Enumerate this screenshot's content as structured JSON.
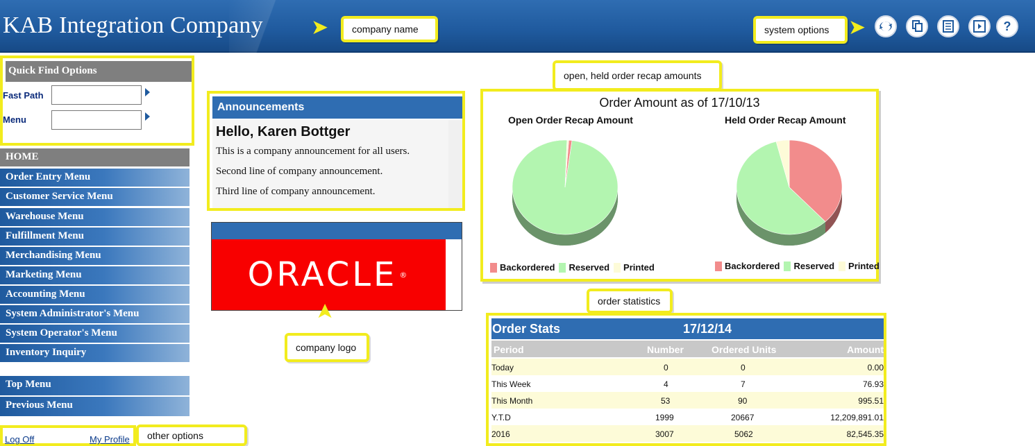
{
  "header": {
    "company_name": "KAB Integration Company"
  },
  "callouts": {
    "company_name": "company name",
    "system_options": "system options",
    "recap": "open, held order recap amounts",
    "order_statistics": "order statistics",
    "company_logo": "company logo",
    "other_options": "other options"
  },
  "system_buttons": [
    "refresh-icon",
    "copy-icon",
    "report-icon",
    "logout-icon",
    "help-icon"
  ],
  "quick_find": {
    "title": "Quick Find Options",
    "fast_path_label": "Fast Path",
    "menu_label": "Menu"
  },
  "menu": {
    "home": "HOME",
    "items": [
      "Order Entry Menu",
      "Customer Service Menu",
      "Warehouse Menu",
      "Fulfillment Menu",
      "Merchandising Menu",
      "Marketing Menu",
      "Accounting Menu",
      "System Administrator's Menu",
      "System Operator's Menu",
      "Inventory Inquiry"
    ],
    "top_menu": "Top Menu",
    "previous_menu": "Previous Menu"
  },
  "links": {
    "log_off": "Log Off",
    "my_profile": "My Profile"
  },
  "announcements": {
    "title": "Announcements",
    "greeting": "Hello, Karen Bottger",
    "lines": [
      "This is a company announcement for all users.",
      "Second line of company announcement.",
      "Third line of company announcement."
    ]
  },
  "logo": {
    "text": "ORACLE",
    "mark": "®"
  },
  "chart_data": [
    {
      "type": "pie",
      "title": "Order Amount as of 17/10/13",
      "subtitle": "Open Order Recap Amount",
      "categories": [
        "Backordered",
        "Reserved",
        "Printed"
      ],
      "values": [
        1,
        98.5,
        0.5
      ],
      "colors": [
        "#f28c8c",
        "#b3f5b0",
        "#fdfbd8"
      ]
    },
    {
      "type": "pie",
      "title": "Order Amount as of 17/10/13",
      "subtitle": "Held Order Recap Amount",
      "categories": [
        "Backordered",
        "Reserved",
        "Printed"
      ],
      "values": [
        38,
        58,
        4
      ],
      "colors": [
        "#f28c8c",
        "#b3f5b0",
        "#fdfbd8"
      ]
    }
  ],
  "chart_header": {
    "title_prefix": "Order Amount as of",
    "date": "17/10/13",
    "open_title": "Open Order Recap Amount",
    "held_title": "Held Order Recap Amount",
    "legend": [
      "Backordered",
      "Reserved",
      "Printed"
    ]
  },
  "order_stats": {
    "title": "Order Stats",
    "date": "17/12/14",
    "columns": [
      "Period",
      "Number",
      "Ordered Units",
      "Amount"
    ],
    "rows": [
      {
        "period": "Today",
        "number": "0",
        "units": "0",
        "amount": "0.00"
      },
      {
        "period": "This Week",
        "number": "4",
        "units": "7",
        "amount": "76.93"
      },
      {
        "period": "This Month",
        "number": "53",
        "units": "90",
        "amount": "995.51"
      },
      {
        "period": "Y.T.D",
        "number": "1999",
        "units": "20667",
        "amount": "12,209,891.01"
      },
      {
        "period": "2016",
        "number": "3007",
        "units": "5062",
        "amount": "82,545.35"
      }
    ]
  }
}
